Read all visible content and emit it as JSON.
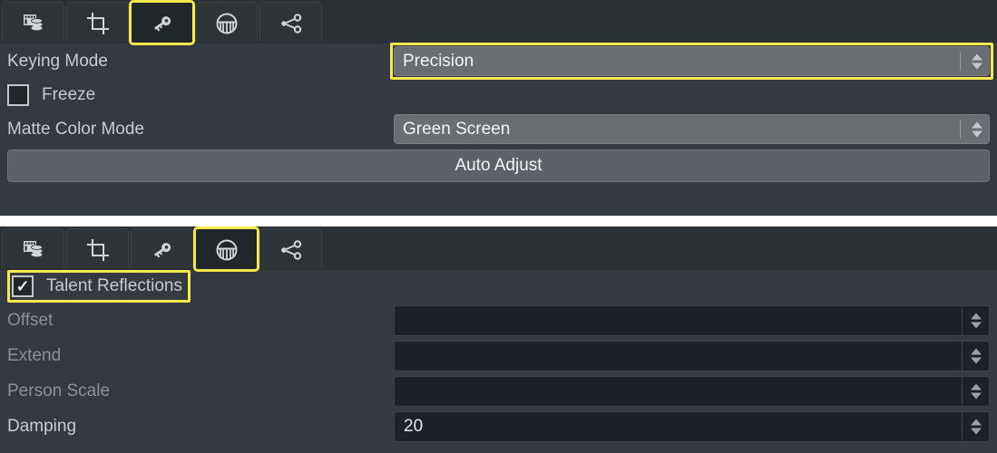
{
  "colors": {
    "highlight": "#f5ea4b",
    "panel_bg": "#343a40",
    "tabbar_bg": "#2b3035",
    "combo_bg": "#6a6e73",
    "field_bg": "#1e2228",
    "text": "#c6cbd1",
    "text_dim": "#8b9097"
  },
  "panels": [
    {
      "name": "keying-panel",
      "tabs": [
        {
          "icon": "media-library-icon",
          "selected": false,
          "highlighted": false
        },
        {
          "icon": "crop-icon",
          "selected": false,
          "highlighted": false
        },
        {
          "icon": "key-icon",
          "selected": true,
          "highlighted": true
        },
        {
          "icon": "reflections-dome-icon",
          "selected": false,
          "highlighted": false
        },
        {
          "icon": "node-share-icon",
          "selected": false,
          "highlighted": false
        }
      ],
      "rows": [
        {
          "label": "Keying Mode",
          "control": "combo",
          "value": "Precision",
          "highlighted": true,
          "disabled": false
        },
        {
          "label": "Freeze",
          "control": "checkbox",
          "checked": false,
          "highlighted": false,
          "disabled": false
        },
        {
          "label": "Matte Color Mode",
          "control": "combo",
          "value": "Green Screen",
          "highlighted": false,
          "disabled": false
        },
        {
          "label": "Auto Adjust",
          "control": "button",
          "highlighted": false,
          "disabled": false
        }
      ]
    },
    {
      "name": "reflections-panel",
      "tabs": [
        {
          "icon": "media-library-icon",
          "selected": false,
          "highlighted": false
        },
        {
          "icon": "crop-icon",
          "selected": false,
          "highlighted": false
        },
        {
          "icon": "key-icon",
          "selected": false,
          "highlighted": false
        },
        {
          "icon": "reflections-dome-icon",
          "selected": true,
          "highlighted": true
        },
        {
          "icon": "node-share-icon",
          "selected": false,
          "highlighted": false
        }
      ],
      "rows": [
        {
          "label": "Talent Reflections",
          "control": "checkbox",
          "checked": true,
          "highlighted": true,
          "disabled": false
        },
        {
          "label": "Offset",
          "control": "number",
          "value": "",
          "highlighted": false,
          "disabled": true
        },
        {
          "label": "Extend",
          "control": "number",
          "value": "",
          "highlighted": false,
          "disabled": true
        },
        {
          "label": "Person Scale",
          "control": "number",
          "value": "",
          "highlighted": false,
          "disabled": true
        },
        {
          "label": "Damping",
          "control": "number",
          "value": "20",
          "highlighted": false,
          "disabled": false
        }
      ]
    }
  ]
}
